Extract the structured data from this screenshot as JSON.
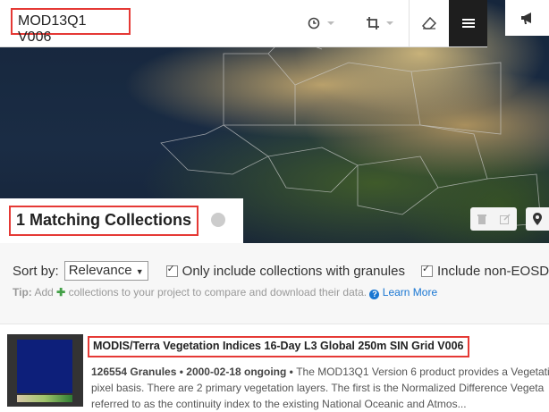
{
  "search": {
    "value": "MOD13Q1 V006"
  },
  "toolbar": {
    "temporal_icon": "clock-icon",
    "spatial_icon": "crop-icon",
    "clear_icon": "eraser-icon",
    "menu_icon": "hamburger-menu-icon",
    "notify_icon": "megaphone-icon"
  },
  "results": {
    "title": "1 Matching Collections"
  },
  "filters": {
    "sort_label": "Sort by:",
    "sort_value": "Relevance",
    "granules_only_label": "Only include collections with granules",
    "granules_only_checked": true,
    "non_eosdis_label": "Include non-EOSD",
    "non_eosdis_checked": true
  },
  "tip": {
    "prefix": "Tip:",
    "text_before": "Add",
    "text_after": "collections to your project to compare and download their data.",
    "learn_more": "Learn More"
  },
  "collection": {
    "title": "MODIS/Terra Vegetation Indices 16-Day L3 Global 250m SIN Grid V006",
    "granules": "126554 Granules",
    "date_range": "2000-02-18 ongoing",
    "line1": "The MOD13Q1 Version 6 product provides a Vegetati",
    "line2": "pixel basis. There are 2 primary vegetation layers. The first is the Normalized Difference Vegeta",
    "line3": "referred to as the continuity index to the existing National Oceanic and Atmos..."
  },
  "colors": {
    "highlight": "#e53935",
    "accent": "#1976d2",
    "add": "#43a047"
  }
}
